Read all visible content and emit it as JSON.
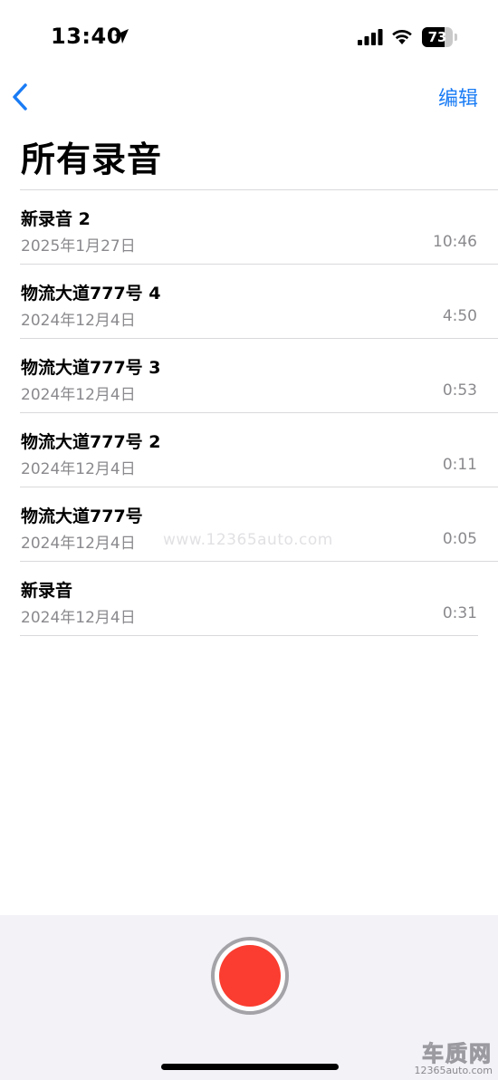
{
  "status_bar": {
    "time": "13:40",
    "battery_level": "73",
    "battery_fraction": 0.73
  },
  "nav": {
    "back_icon": "chevron-left-icon",
    "edit_label": "编辑"
  },
  "page": {
    "title": "所有录音"
  },
  "recordings": [
    {
      "title": "新录音 2",
      "date": "2025年1月27日",
      "duration": "10:46"
    },
    {
      "title": "物流大道777号 4",
      "date": "2024年12月4日",
      "duration": "4:50"
    },
    {
      "title": "物流大道777号 3",
      "date": "2024年12月4日",
      "duration": "0:53"
    },
    {
      "title": "物流大道777号 2",
      "date": "2024年12月4日",
      "duration": "0:11"
    },
    {
      "title": "物流大道777号",
      "date": "2024年12月4日",
      "duration": "0:05"
    },
    {
      "title": "新录音",
      "date": "2024年12月4日",
      "duration": "0:31"
    }
  ],
  "watermark": {
    "center_text": "www.12365auto.com",
    "brand_main": "车质网",
    "brand_sub": "12365auto.com"
  },
  "colors": {
    "accent": "#1a7cf5",
    "record": "#fa3d30",
    "secondary_text": "#8a8a8e",
    "panel_bg": "#f2f2f7"
  }
}
